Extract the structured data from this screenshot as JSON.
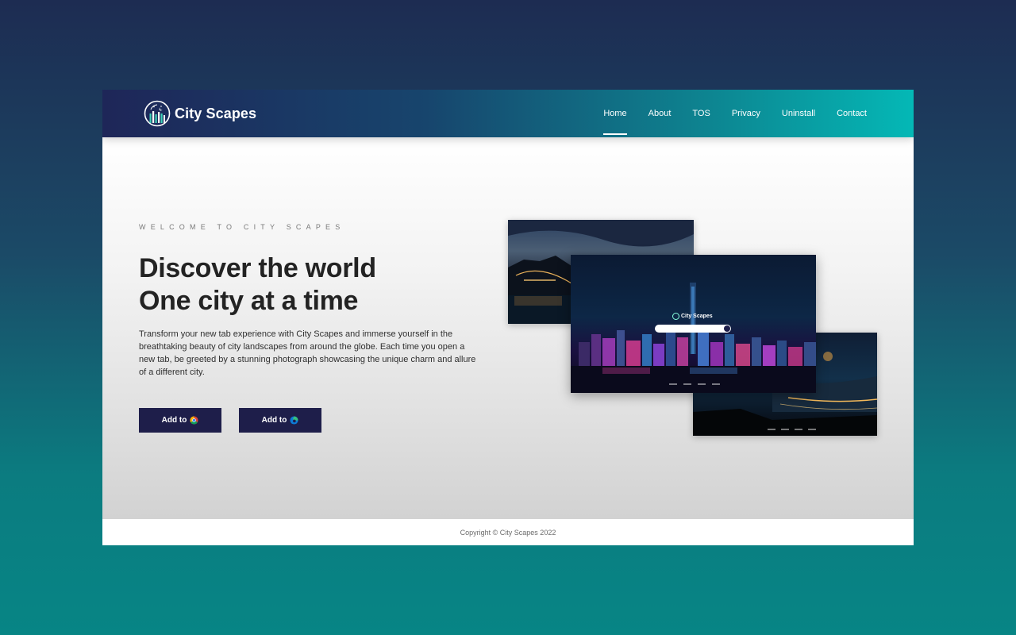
{
  "header": {
    "brand_name": "City Scapes",
    "nav": [
      "Home",
      "About",
      "TOS",
      "Privacy",
      "Uninstall",
      "Contact"
    ],
    "active_nav": "Home"
  },
  "hero": {
    "eyebrow": "Welcome to City Scapes",
    "headline_line1": "Discover the world",
    "headline_line2": "One city at a time",
    "description": "Transform your new tab experience with City Scapes and immerse yourself in the breathtaking beauty of city landscapes from around the globe. Each time you open a new tab, be greeted by a stunning photograph showcasing the unique charm and allure of a different city.",
    "buttons": {
      "chrome_label": "Add to",
      "edge_label": "Add to"
    }
  },
  "preview": {
    "brand_name": "City Scapes"
  },
  "footer": {
    "copyright": "Copyright © City Scapes 2022"
  },
  "colors": {
    "button_bg": "#1e1e4a",
    "accent": "#04b8b6",
    "nav_start": "#1e2658"
  },
  "icons": {
    "brand": "city-skyline-circle-icon",
    "chrome": "chrome-icon",
    "edge": "edge-icon"
  }
}
